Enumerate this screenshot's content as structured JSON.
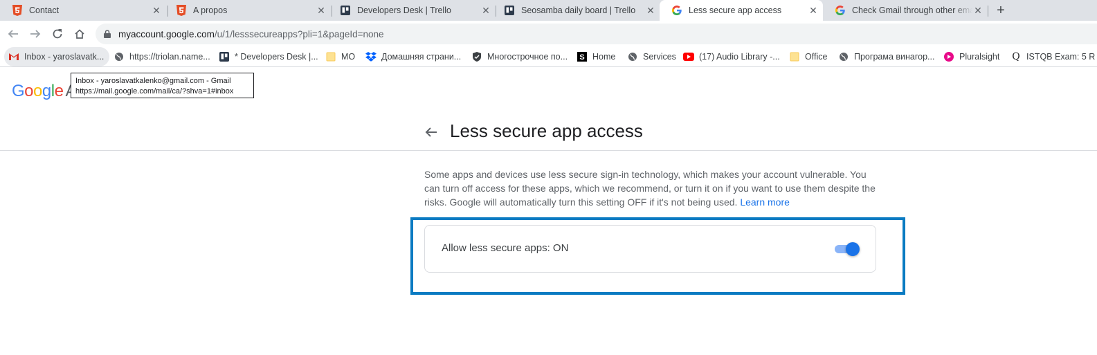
{
  "colors": {
    "accent": "#1a73e8",
    "highlight_border": "#0a7bc2",
    "toggle_track": "#8ab4f8",
    "tab_strip": "#dee1e6"
  },
  "tabs": [
    {
      "title": "Contact",
      "icon": "html5-icon",
      "active": false
    },
    {
      "title": "A propos",
      "icon": "html5-icon",
      "active": false
    },
    {
      "title": "Developers Desk | Trello",
      "icon": "trello-icon",
      "active": false
    },
    {
      "title": "Seosamba daily board | Trello",
      "icon": "trello-icon",
      "active": false
    },
    {
      "title": "Less secure app access",
      "icon": "google-icon",
      "active": true
    },
    {
      "title": "Check Gmail through other emai",
      "icon": "google-icon",
      "active": false
    }
  ],
  "address_bar": {
    "host": "myaccount.google.com",
    "path": "/u/1/lesssecureapps?pli=1&pageId=none"
  },
  "bookmarks": [
    {
      "label": "Inbox - yaroslavatk...",
      "icon": "gmail-icon"
    },
    {
      "label": "https://triolan.name...",
      "icon": "globe-icon"
    },
    {
      "label": "* Developers Desk |...",
      "icon": "trello-icon"
    },
    {
      "label": "MO",
      "icon": "folder-icon"
    },
    {
      "label": "Домашняя страни...",
      "icon": "dropbox-icon"
    },
    {
      "label": "Многострочное по...",
      "icon": "shield-icon"
    },
    {
      "label": "Home",
      "icon": "s-logo-icon"
    },
    {
      "label": "Services",
      "icon": "globe-icon"
    },
    {
      "label": "(17) Audio Library -...",
      "icon": "youtube-icon"
    },
    {
      "label": "Office",
      "icon": "folder-icon"
    },
    {
      "label": "Програма винагор...",
      "icon": "globe-icon"
    },
    {
      "label": "Pluralsight",
      "icon": "pluralsight-icon"
    },
    {
      "label": "ISTQB Exam: 5 R",
      "icon": "q-logo-icon"
    }
  ],
  "tooltip": {
    "line1": "Inbox - yaroslavatkalenko@gmail.com - Gmail",
    "line2": "https://mail.google.com/mail/ca/?shva=1#inbox"
  },
  "header": {
    "logo_text": "Google",
    "logo_suffix": "A"
  },
  "page": {
    "title": "Less secure app access",
    "description": "Some apps and devices use less secure sign-in technology, which makes your account vulnerable. You can turn off access for these apps, which we recommend, or turn it on if you want to use them despite the risks. Google will automatically turn this setting OFF if it's not being used.",
    "learn_more": "Learn more",
    "setting_label": "Allow less secure apps: ON",
    "setting_on": true
  }
}
